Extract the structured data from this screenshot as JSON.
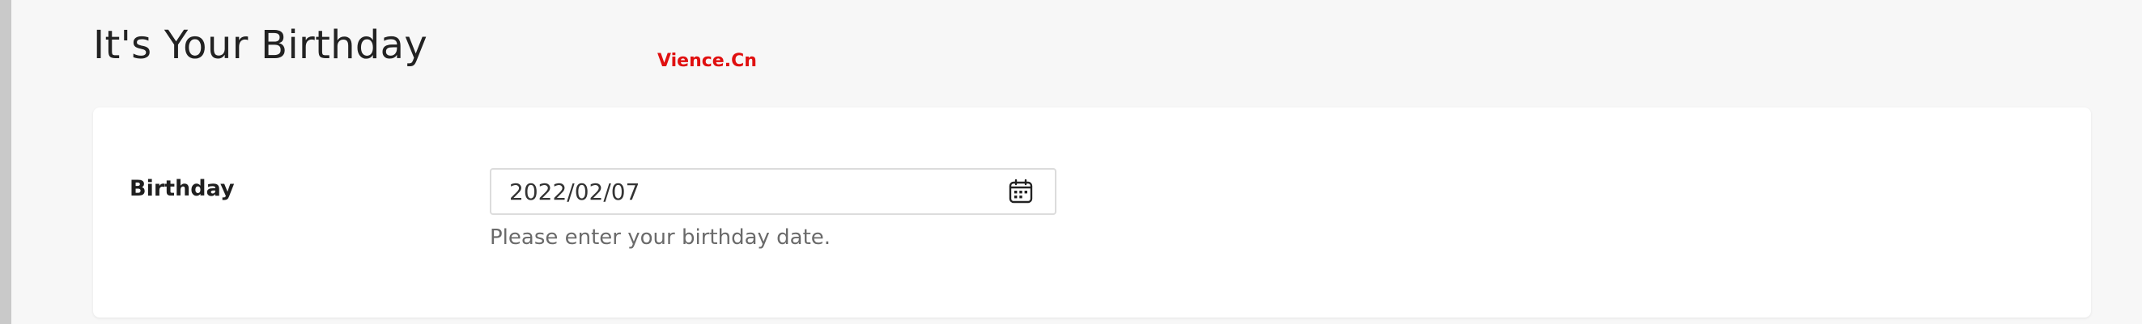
{
  "page": {
    "title": "It's Your Birthday",
    "watermark": "Vience.Cn"
  },
  "form": {
    "birthday_label": "Birthday",
    "birthday_value": "2022/02/07",
    "birthday_help": "Please enter your birthday date.",
    "calendar_icon": "calendar-icon"
  },
  "colors": {
    "background": "#f7f7f7",
    "card": "#ffffff",
    "watermark": "#e01010",
    "help_text": "#6a6a6a"
  }
}
